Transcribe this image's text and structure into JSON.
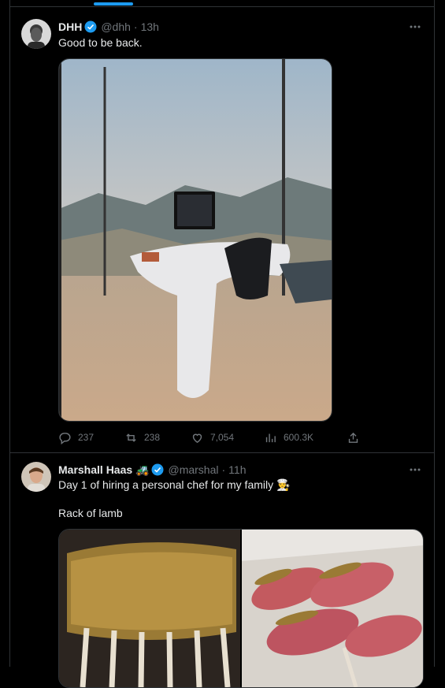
{
  "tweets": [
    {
      "name": "DHH",
      "handle": "@dhh",
      "time": "13h",
      "text": "Good to be back.",
      "stats": {
        "replies": "237",
        "reposts": "238",
        "likes": "7,054",
        "views": "600.3K"
      }
    },
    {
      "name": "Marshall Haas 🚜",
      "handle": "@marshal",
      "time": "11h",
      "text_line1": "Day 1 of hiring a personal chef for my family 👨‍🍳",
      "text_line2": "Rack of lamb"
    }
  ],
  "icons": {
    "verified": "verified-badge-icon",
    "more": "more-icon",
    "reply": "reply-icon",
    "repost": "repost-icon",
    "like": "like-icon",
    "views": "views-icon",
    "share": "share-icon"
  },
  "colors": {
    "background": "#000000",
    "text": "#e7e9ea",
    "muted": "#71767b",
    "accent": "#1d9bf0",
    "border": "#2f3336"
  }
}
